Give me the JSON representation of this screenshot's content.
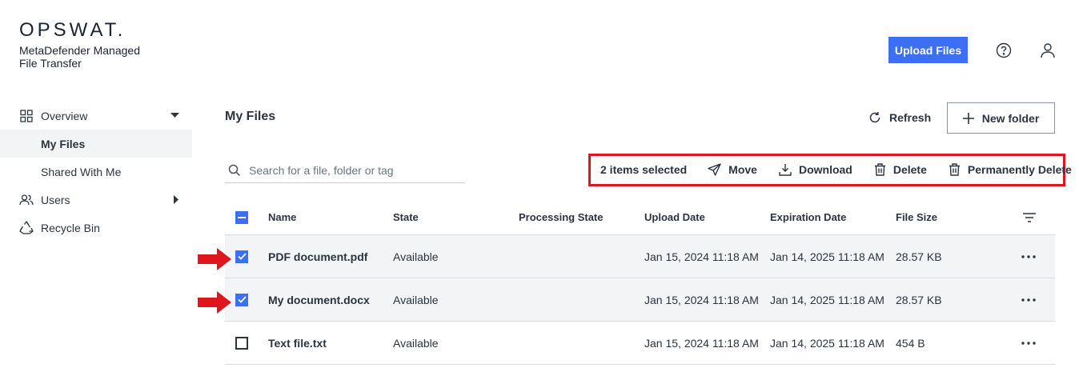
{
  "brand": {
    "logo": "OPSWAT.",
    "product_line1": "MetaDefender Managed",
    "product_line2": "File Transfer"
  },
  "sidebar": {
    "items": [
      {
        "label": "Overview",
        "icon": "grid-icon"
      },
      {
        "label": "My Files"
      },
      {
        "label": "Shared With Me"
      },
      {
        "label": "Users",
        "icon": "users-icon"
      },
      {
        "label": "Recycle Bin",
        "icon": "recycle-icon"
      }
    ]
  },
  "header": {
    "upload_label": "Upload Files"
  },
  "main": {
    "title": "My Files",
    "refresh_label": "Refresh",
    "new_folder_label": "New folder",
    "search_placeholder": "Search for a file, folder or tag",
    "selection": {
      "count_label": "2 items selected",
      "move_label": "Move",
      "download_label": "Download",
      "delete_label": "Delete",
      "perm_delete_label": "Permanently Delete"
    },
    "columns": [
      "Name",
      "State",
      "Processing State",
      "Upload Date",
      "Expiration Date",
      "File Size"
    ],
    "rows": [
      {
        "name": "PDF document.pdf",
        "state": "Available",
        "processing": "",
        "upload": "Jan 15, 2024 11:18 AM",
        "expiration": "Jan 14, 2025 11:18 AM",
        "size": "28.57 KB",
        "checked": true
      },
      {
        "name": "My document.docx",
        "state": "Available",
        "processing": "",
        "upload": "Jan 15, 2024 11:18 AM",
        "expiration": "Jan 14, 2025 11:18 AM",
        "size": "28.57 KB",
        "checked": true
      },
      {
        "name": "Text file.txt",
        "state": "Available",
        "processing": "",
        "upload": "Jan 15, 2024 11:18 AM",
        "expiration": "Jan 14, 2025 11:18 AM",
        "size": "454 B",
        "checked": false
      }
    ]
  },
  "colors": {
    "accent": "#3d6ff5",
    "highlight": "#e0161f",
    "row_selected": "#f3f4f6"
  }
}
